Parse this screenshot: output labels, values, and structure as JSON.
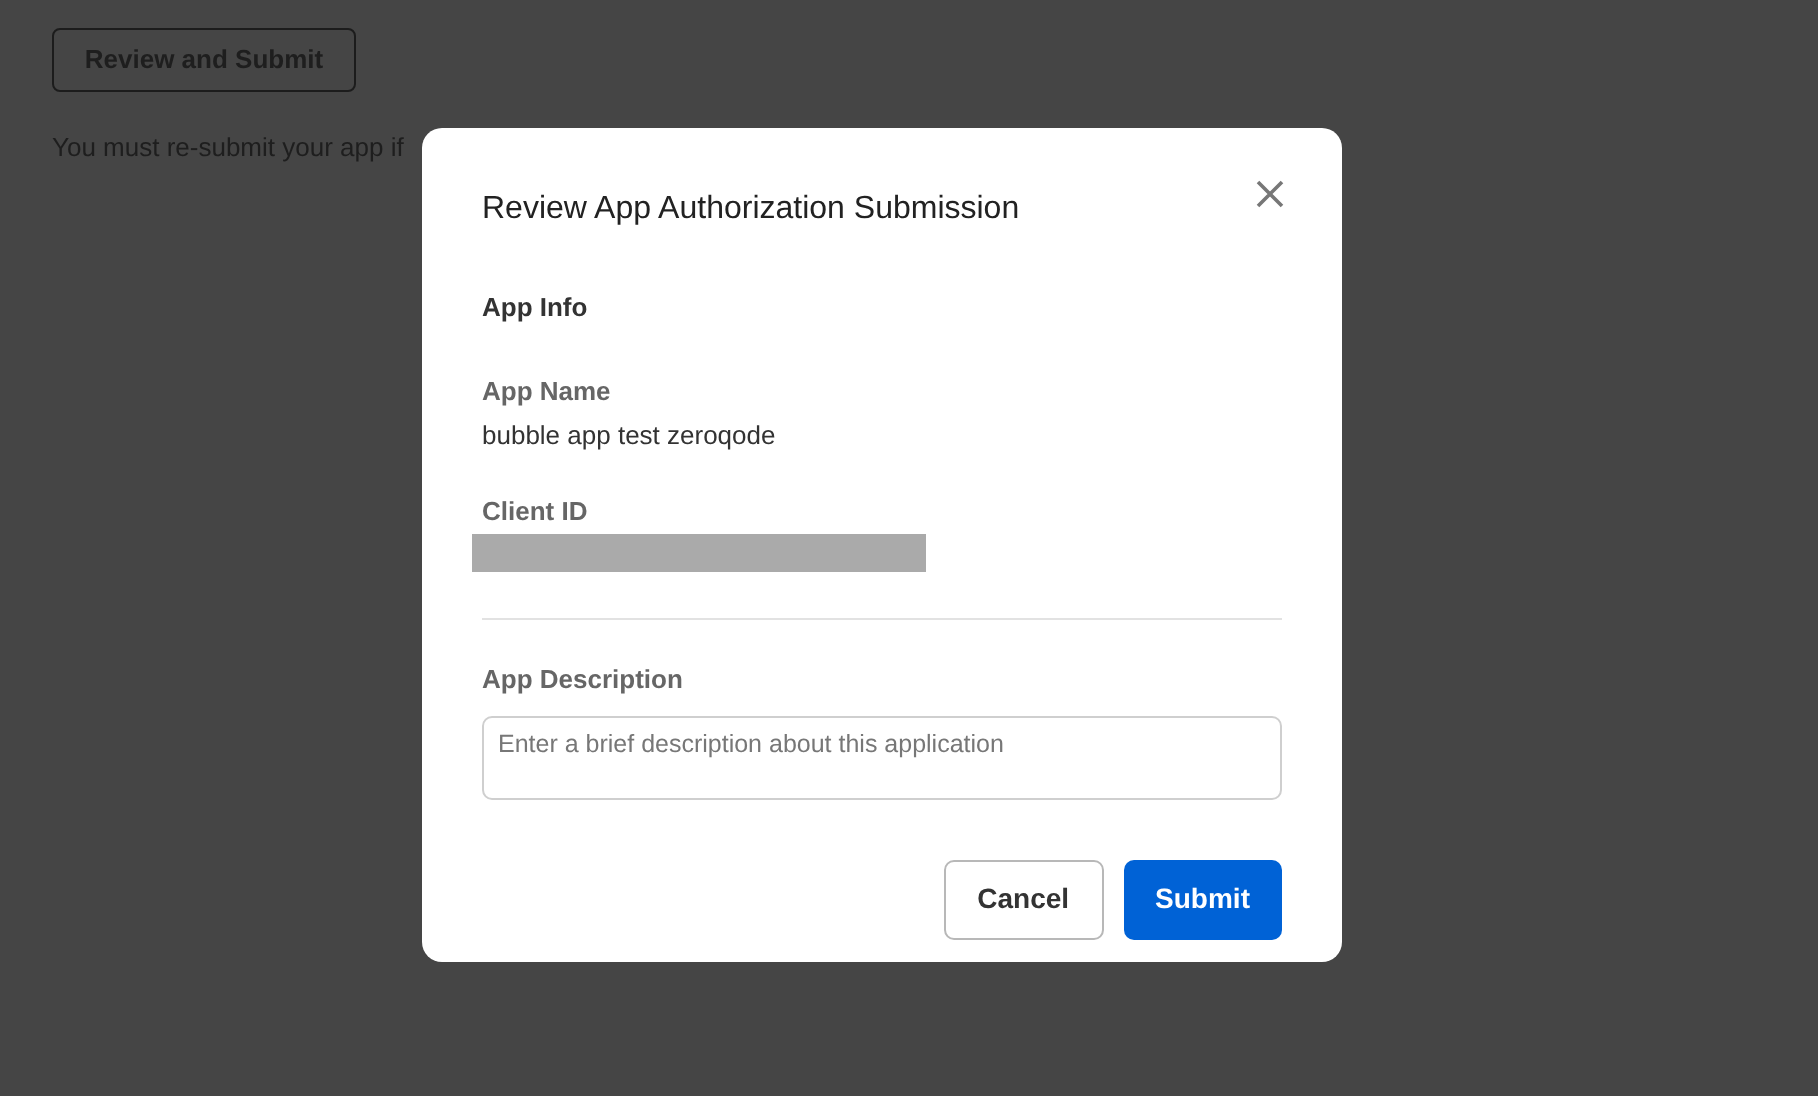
{
  "page": {
    "review_button": "Review and Submit",
    "notice": "You must re-submit your app if"
  },
  "dialog": {
    "title": "Review App Authorization Submission",
    "section": "App Info",
    "app_name": {
      "label": "App Name",
      "value": "bubble app test zeroqode"
    },
    "client_id": {
      "label": "Client ID"
    },
    "description": {
      "label": "App Description",
      "placeholder": "Enter a brief description about this application"
    },
    "buttons": [
      {
        "kind": "secondary",
        "label": "Cancel"
      },
      {
        "kind": "primary",
        "label": "Submit"
      }
    ]
  }
}
